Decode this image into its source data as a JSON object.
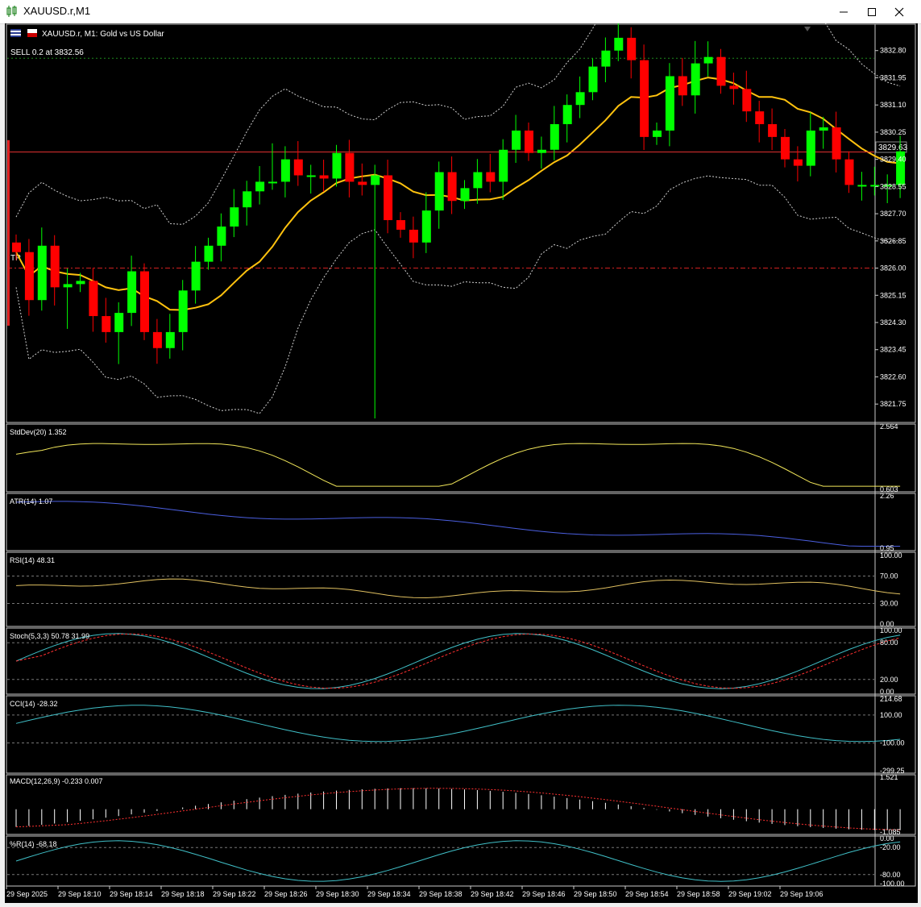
{
  "window": {
    "title": "XAUUSD.r,M1"
  },
  "chart_header": {
    "symbol_desc": "XAUUSD.r, M1:  Gold vs US Dollar",
    "trade_label": "SELL 0.2 at 3832.56",
    "tp_label": "TP"
  },
  "colors": {
    "bull": "#00ff00",
    "bear": "#ff0000",
    "ma": "#ffc20e",
    "bands": "#cfcfcf",
    "stddev": "#f2e75a",
    "atr": "#4b5fe0",
    "rsi": "#e0c060",
    "stoch_main": "#40c0c8",
    "stoch_signal": "#ff3030",
    "cci": "#40c0c8",
    "macd_signal": "#ff3030",
    "wpr": "#40c0c8"
  },
  "price_axis": [
    "3832.80",
    "3831.95",
    "3831.10",
    "3830.25",
    "3829.40",
    "3828.55",
    "3827.70",
    "3826.85",
    "3826.00",
    "3825.15",
    "3824.30",
    "3823.45",
    "3822.60",
    "3821.75"
  ],
  "current_price": "3829.63",
  "time_axis": [
    "29 Sep 2025",
    "29 Sep 18:10",
    "29 Sep 18:14",
    "29 Sep 18:18",
    "29 Sep 18:22",
    "29 Sep 18:26",
    "29 Sep 18:30",
    "29 Sep 18:34",
    "29 Sep 18:38",
    "29 Sep 18:42",
    "29 Sep 18:46",
    "29 Sep 18:50",
    "29 Sep 18:54",
    "29 Sep 18:58",
    "29 Sep 19:02",
    "29 Sep 19:06"
  ],
  "indicators": {
    "stddev": {
      "label": "StdDev(20) 1.352",
      "axis": [
        "2.564",
        "0.603"
      ]
    },
    "atr": {
      "label": "ATR(14) 1.07",
      "axis": [
        "2.26",
        "0.95"
      ]
    },
    "rsi": {
      "label": "RSI(14) 48.31",
      "axis": [
        "100.00",
        "70.00",
        "30.00",
        "0.00"
      ]
    },
    "stoch": {
      "label": "Stoch(5,3,3) 50.78 31.99",
      "axis": [
        "100.00",
        "80.00",
        "20.00",
        "0.00"
      ]
    },
    "cci": {
      "label": "CCI(14) -28.32",
      "axis": [
        "214.68",
        "100.00",
        "-100.00",
        "-299.25"
      ]
    },
    "macd": {
      "label": "MACD(12,26,9) -0.233 0.007",
      "axis": [
        "1.521",
        "-1.085"
      ]
    },
    "wpr": {
      "label": "%R(14) -68.18",
      "axis": [
        "0.00",
        "-20.00",
        "-80.00",
        "-100.00"
      ]
    }
  },
  "chart_data": {
    "type": "candlestick",
    "symbol": "XAUUSD.r",
    "timeframe": "M1",
    "price_range": [
      3821.2,
      3833.6
    ],
    "opens": [
      3826.8,
      3826.5,
      3825.0,
      3826.7,
      3825.4,
      3825.5,
      3825.6,
      3824.5,
      3824.0,
      3824.6,
      3825.9,
      3824.0,
      3823.5,
      3824.0,
      3825.3,
      3826.2,
      3826.7,
      3827.3,
      3827.9,
      3828.4,
      3828.7,
      3828.7,
      3829.4,
      3828.9,
      3828.9,
      3828.8,
      3829.6,
      3828.7,
      3828.6,
      3828.9,
      3827.5,
      3827.2,
      3826.8,
      3827.8,
      3829.0,
      3828.1,
      3828.5,
      3829.0,
      3828.7,
      3829.7,
      3830.3,
      3829.6,
      3829.7,
      3830.5,
      3831.1,
      3831.5,
      3832.3,
      3832.8,
      3833.2,
      3832.5,
      3830.1,
      3830.3,
      3832.0,
      3831.4,
      3832.4,
      3832.6,
      3831.7,
      3831.6,
      3830.9,
      3830.5,
      3830.1,
      3829.4,
      3829.2,
      3830.3,
      3830.4,
      3829.4,
      3828.6,
      3828.6,
      3828.6,
      3828.6
    ]
  }
}
